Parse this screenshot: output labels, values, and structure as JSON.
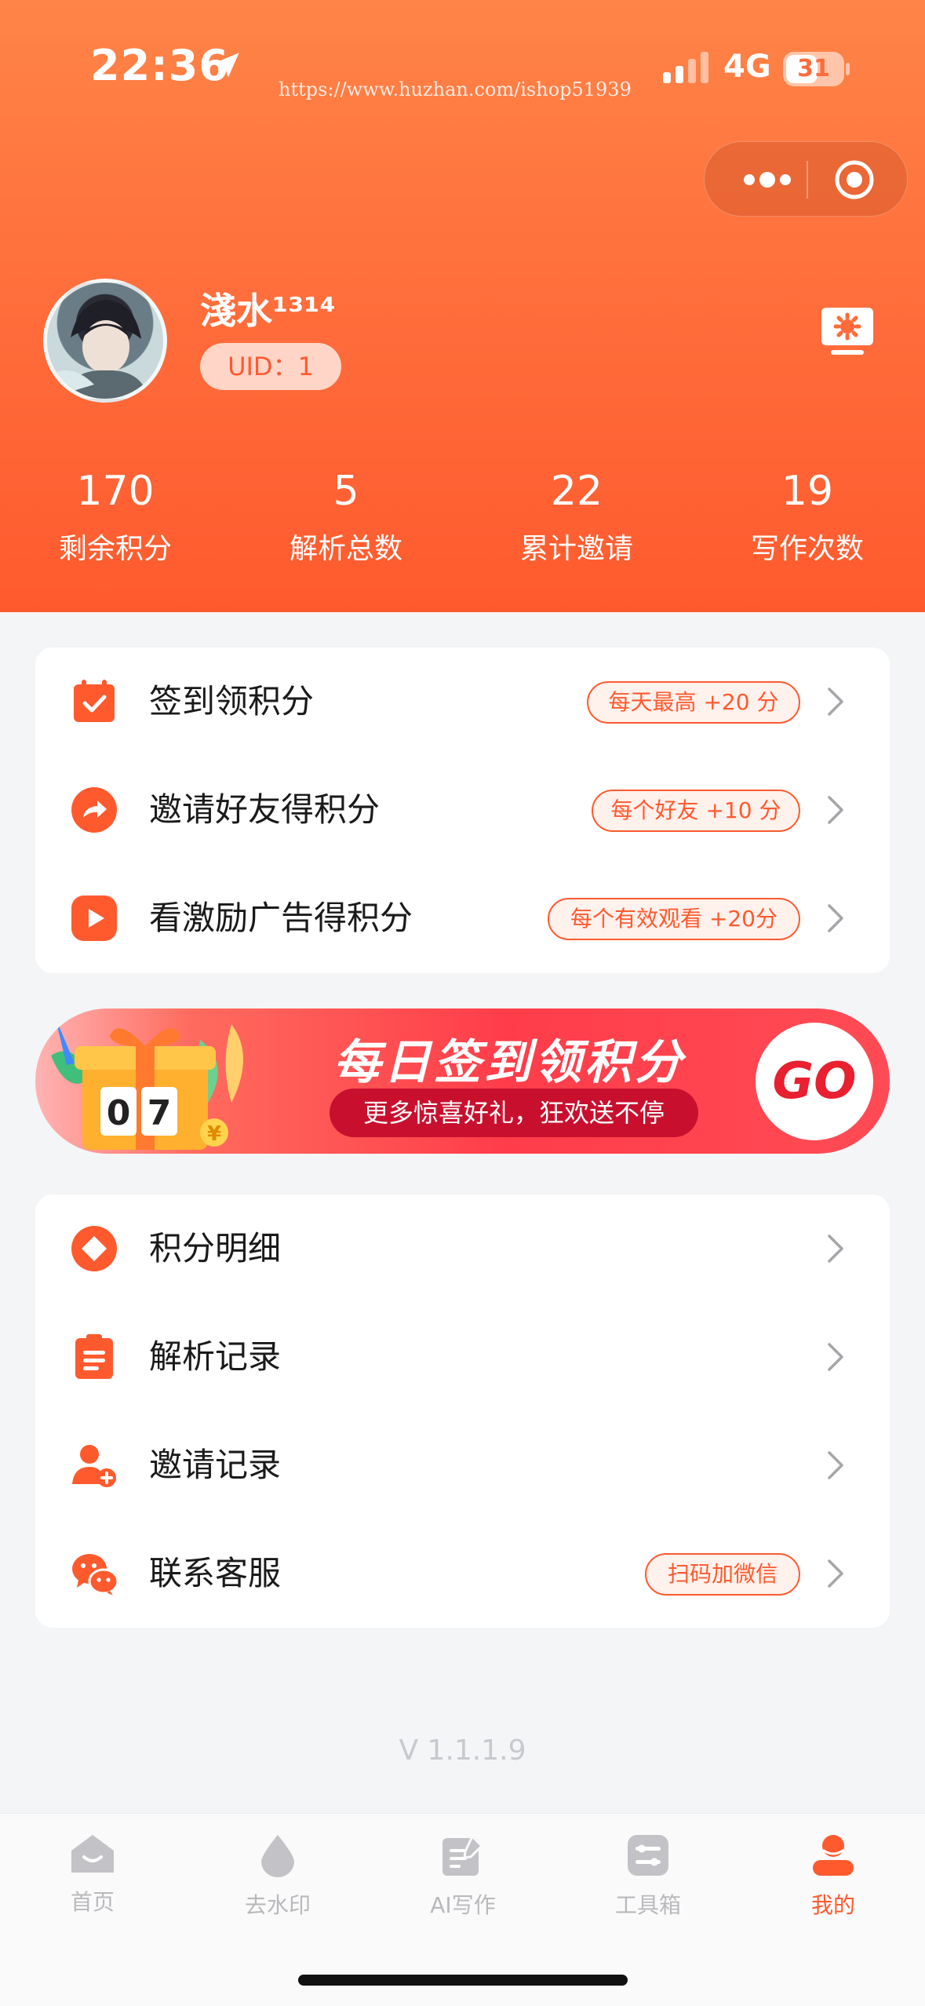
{
  "status_bar": {
    "time": "22:36",
    "network": "4G",
    "battery": "31",
    "watermark": "https://www.huzhan.com/ishop51939"
  },
  "profile": {
    "name": "淺水¹³¹⁴",
    "uid": "UID：1"
  },
  "stats": [
    {
      "value": "170",
      "label": "剩余积分"
    },
    {
      "value": "5",
      "label": "解析总数"
    },
    {
      "value": "22",
      "label": "累计邀请"
    },
    {
      "value": "19",
      "label": "写作次数"
    }
  ],
  "tasks": [
    {
      "label": "签到领积分",
      "tag": "每天最高 +20 分",
      "icon": "calendar-check-icon"
    },
    {
      "label": "邀请好友得积分",
      "tag": "每个好友 +10 分",
      "icon": "share-arrow-icon"
    },
    {
      "label": "看激励广告得积分",
      "tag": "每个有效观看 +20分",
      "icon": "play-icon"
    }
  ],
  "banner": {
    "title": "每日签到领积分",
    "subtitle": "更多惊喜好礼，狂欢送不停",
    "button": "GO",
    "counter": "07",
    "coin": "¥"
  },
  "menu": [
    {
      "label": "积分明细",
      "icon": "points-diamond-icon",
      "tag": ""
    },
    {
      "label": "解析记录",
      "icon": "clipboard-list-icon",
      "tag": ""
    },
    {
      "label": "邀请记录",
      "icon": "user-add-icon",
      "tag": ""
    },
    {
      "label": "联系客服",
      "icon": "wechat-icon",
      "tag": "扫码加微信"
    }
  ],
  "version": "V 1.1.1.9",
  "tabs": [
    {
      "label": "首页",
      "icon": "home-icon",
      "active": false
    },
    {
      "label": "去水印",
      "icon": "water-drop-icon",
      "active": false
    },
    {
      "label": "AI写作",
      "icon": "edit-note-icon",
      "active": false
    },
    {
      "label": "工具箱",
      "icon": "toolbox-icon",
      "active": false
    },
    {
      "label": "我的",
      "icon": "user-icon",
      "active": true
    }
  ],
  "colors": {
    "accent": "#ff5a2e",
    "header_top": "#ff8447",
    "background": "#f4f5f7"
  }
}
